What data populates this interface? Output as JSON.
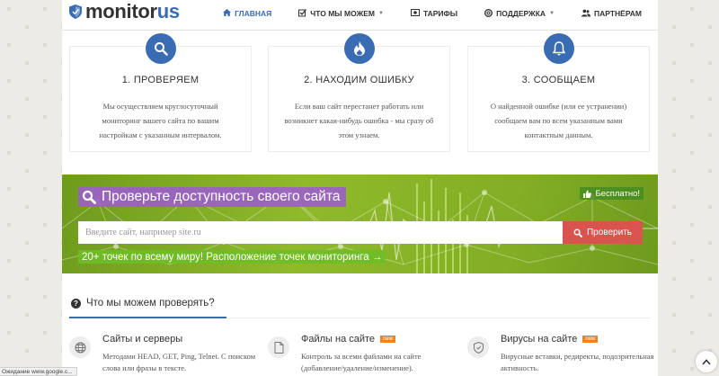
{
  "logo": {
    "part1": "monitor",
    "part2": "us"
  },
  "nav": {
    "items": [
      {
        "label": "ГЛАВНАЯ",
        "icon": "home-icon",
        "active": true,
        "dropdown": false
      },
      {
        "label": "ЧТО МЫ МОЖЕМ",
        "icon": "checkbox-icon",
        "active": false,
        "dropdown": true
      },
      {
        "label": "ТАРИФЫ",
        "icon": "money-icon",
        "active": false,
        "dropdown": false
      },
      {
        "label": "ПОДДЕРЖКА",
        "icon": "lifebuoy-icon",
        "active": false,
        "dropdown": true
      },
      {
        "label": "ПАРТНЁРАМ",
        "icon": "users-icon",
        "active": false,
        "dropdown": false
      }
    ]
  },
  "steps": [
    {
      "icon": "search-icon",
      "title": "1. ПРОВЕРЯЕМ",
      "text": "Мы осуществляем круглосуточный мониторинг вашего сайта по вашим настройкам с указанным интервалом."
    },
    {
      "icon": "fire-icon",
      "title": "2. НАХОДИМ ОШИБКУ",
      "text": "Если ваш сайт перестанет работать или возникнет какая-нибудь ошибка - мы сразу об этом узнаем."
    },
    {
      "icon": "bell-icon",
      "title": "3. СООБЩАЕМ",
      "text": "О найденной ошибке (или ее устранении) сообщаем вам по всем указанным вами контактным данным."
    }
  ],
  "banner": {
    "title": "Проверьте доступность своего сайта",
    "free_badge": "Бесплатно!",
    "input_placeholder": "Введите сайт, например site.ru",
    "button_label": "Проверить",
    "points_link": "20+ точек по всему миру! Расположение точек мониторинга →"
  },
  "features": {
    "heading": "Что мы можем проверять?",
    "items": [
      {
        "icon": "globe-icon",
        "title": "Сайты и серверы",
        "new": "",
        "text": "Методами HEAD, GET, Ping, Telnet. С поиском слова или фразы в тексте."
      },
      {
        "icon": "file-icon",
        "title": "Файлы на сайте",
        "new": "new",
        "text": "Контроль за всеми файлами на сайте (добавление/удаление/изменение)."
      },
      {
        "icon": "shield-icon",
        "title": "Вирусы на сайте",
        "new": "new",
        "text": "Вирусные вставки, редиректы, подозрительная активность."
      }
    ]
  },
  "statusbar": {
    "text": "Ожидание www.google.c..."
  },
  "colors": {
    "brand_blue": "#3a6cb4",
    "banner_green": "#8fba2a",
    "button_red": "#d9534f",
    "title_purple": "#9b5fc8",
    "new_orange": "#e8842c"
  }
}
